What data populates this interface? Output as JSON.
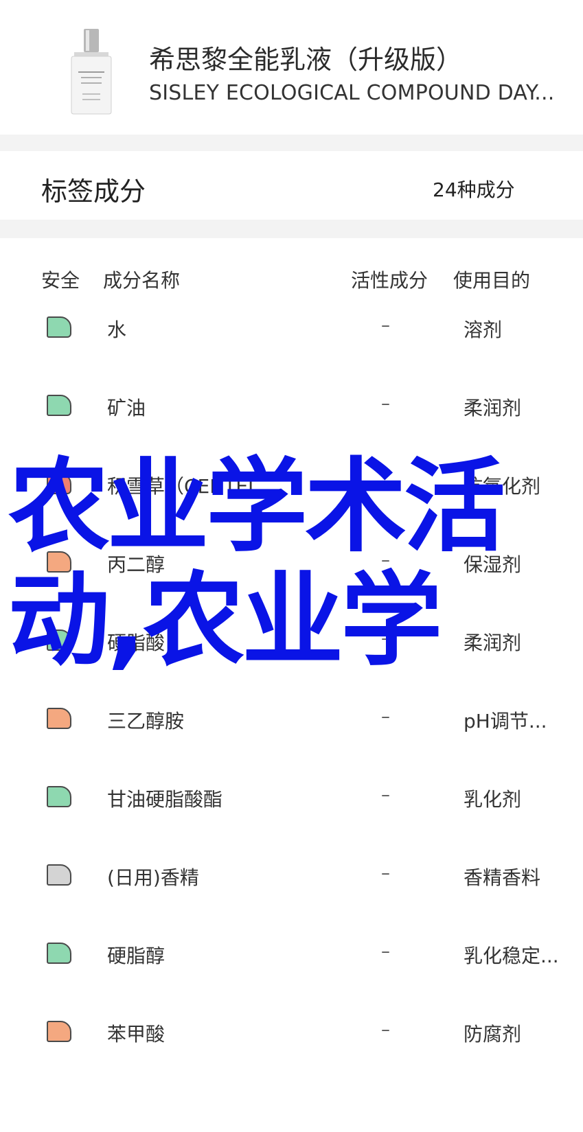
{
  "product": {
    "name_cn": "希思黎全能乳液（升级版）",
    "name_en": "SISLEY ECOLOGICAL COMPOUND DAY...",
    "image_icon": "product-bottle-icon"
  },
  "tag_section": {
    "title": "标签成分",
    "count": "24种成分"
  },
  "table_header": {
    "safety": "安全",
    "name": "成分名称",
    "active": "活性成分",
    "use": "使用目的"
  },
  "rows": [
    {
      "name": "水",
      "active": "–",
      "use": "溶剂",
      "color": "#8ed8b0"
    },
    {
      "name": "矿油",
      "active": "–",
      "use": "柔润剂",
      "color": "#8ed8b0"
    },
    {
      "name": "积雪草（CENTEL...",
      "active": "–",
      "use": "抗氧化剂",
      "color": "#f08070"
    },
    {
      "name": "丙二醇",
      "active": "–",
      "use": "保湿剂",
      "color": "#f4a880"
    },
    {
      "name": "硬脂酸",
      "active": "–",
      "use": "柔润剂",
      "color": "#8ed8b0"
    },
    {
      "name": "三乙醇胺",
      "active": "–",
      "use": "pH调节...",
      "color": "#f4a880"
    },
    {
      "name": "甘油硬脂酸酯",
      "active": "–",
      "use": "乳化剂",
      "color": "#8ed8b0"
    },
    {
      "name": "(日用)香精",
      "active": "–",
      "use": "香精香料",
      "color": "#d4d4d4"
    },
    {
      "name": "硬脂醇",
      "active": "–",
      "use": "乳化稳定...",
      "color": "#8ed8b0"
    },
    {
      "name": "苯甲酸",
      "active": "–",
      "use": "防腐剂",
      "color": "#f4a880"
    }
  ],
  "overlay": {
    "line1": "农业学术活",
    "line2": "动,农业学"
  },
  "colors": {
    "overlay": "#0a14e6",
    "safe": "#8ed8b0",
    "moderate": "#f4a880",
    "risk": "#f08070",
    "unknown": "#d4d4d4"
  }
}
